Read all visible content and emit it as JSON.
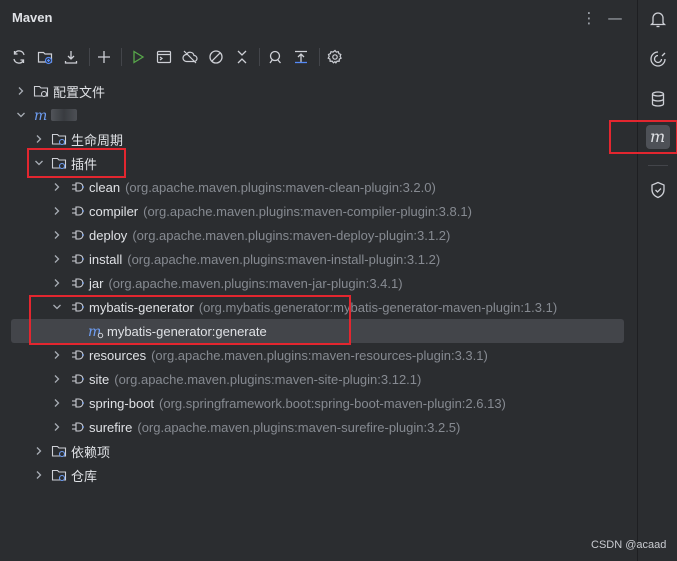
{
  "header": {
    "title": "Maven",
    "more_icon": "more-vertical-icon",
    "minimize_icon": "minimize-icon"
  },
  "toolbar": {
    "items": [
      "reload-icon",
      "add-folder-icon",
      "download-icon",
      "plus-icon",
      "run-icon",
      "execute-goal-icon",
      "offline-icon",
      "skip-tests-icon",
      "collapse-icon",
      "analyze-icon",
      "expand-icon",
      "settings-icon"
    ]
  },
  "tree": {
    "config_files": "配置文件",
    "project_name": "m",
    "lifecycle": "生命周期",
    "plugins": "插件",
    "plugin_items": [
      {
        "name": "clean",
        "coord": "(org.apache.maven.plugins:maven-clean-plugin:3.2.0)"
      },
      {
        "name": "compiler",
        "coord": "(org.apache.maven.plugins:maven-compiler-plugin:3.8.1)"
      },
      {
        "name": "deploy",
        "coord": "(org.apache.maven.plugins:maven-deploy-plugin:3.1.2)"
      },
      {
        "name": "install",
        "coord": "(org.apache.maven.plugins:maven-install-plugin:3.1.2)"
      },
      {
        "name": "jar",
        "coord": "(org.apache.maven.plugins:maven-jar-plugin:3.4.1)"
      },
      {
        "name": "mybatis-generator",
        "coord": "(org.mybatis.generator:mybatis-generator-maven-plugin:1.3.1)"
      },
      {
        "name": "resources",
        "coord": "(org.apache.maven.plugins:maven-resources-plugin:3.3.1)"
      },
      {
        "name": "site",
        "coord": "(org.apache.maven.plugins:maven-site-plugin:3.12.1)"
      },
      {
        "name": "spring-boot",
        "coord": "(org.springframework.boot:spring-boot-maven-plugin:2.6.13)"
      },
      {
        "name": "surefire",
        "coord": "(org.apache.maven.plugins:maven-surefire-plugin:3.2.5)"
      }
    ],
    "goal": "mybatis-generator:generate",
    "dependencies": "依赖项",
    "repositories": "仓库"
  },
  "rightbar": [
    "notifications-icon",
    "ai-assistant-icon",
    "database-icon",
    "maven-icon",
    "security-icon"
  ],
  "watermark": "CSDN @acaad",
  "colors": {
    "background": "#2b2d30",
    "selection": "#43454a",
    "highlight_box": "#e3262f",
    "plugin_icon": "#6f9ff5"
  }
}
